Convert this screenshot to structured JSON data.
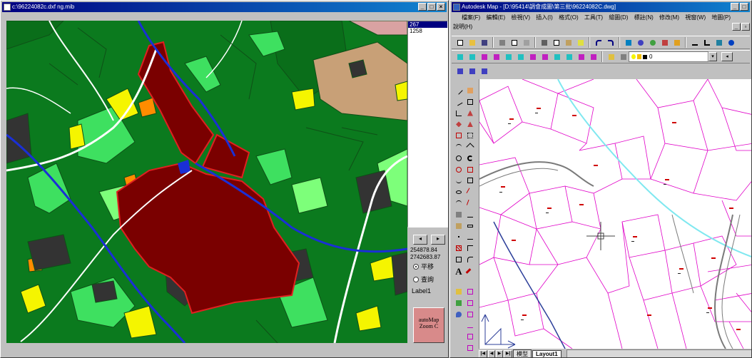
{
  "left_window": {
    "title": "c:\\96224082c.dxf ng.mib",
    "buttons": [
      "_",
      "□",
      "×"
    ],
    "sidebar_list": [
      "267",
      "1258"
    ],
    "coord_x": "254878.84",
    "coord_y": "2742683.87",
    "radio_pan": "平移",
    "radio_query": "查詢",
    "label": "Label1",
    "zoom_button": "autoMap Zoom C",
    "colors": {
      "dark_green": "#0b7a1e",
      "maroon": "#7a0000",
      "light_green": "#3ee060",
      "lime": "#7dff7a",
      "yellow": "#f5f500",
      "orange": "#ff8c00",
      "dark_gray": "#333333",
      "blue_road": "#1a2fd6",
      "tan": "#c8a077"
    }
  },
  "right_window": {
    "title": "Autodesk Map - [D:\\95414\\調會成圖\\第三批\\96224082C.dwg]",
    "buttons": [
      "_",
      "□",
      "×"
    ],
    "menu": [
      "檔案(F)",
      "編輯(E)",
      "檢視(V)",
      "插入(I)",
      "格式(O)",
      "工具(T)",
      "繪圖(D)",
      "標註(N)",
      "修改(M)",
      "視窗(W)",
      "地圖(P)"
    ],
    "menu2": [
      "說明(H)"
    ],
    "layer_value": "0",
    "tabs": [
      "模型",
      "Layout1"
    ],
    "nav_buttons": [
      "|◀",
      "◀",
      "▶",
      "▶|"
    ],
    "colors": {
      "magenta": "#e000c8",
      "cyan": "#80e8f0",
      "gray_road": "#7a7a7a",
      "navy_road": "#2d3f9a"
    }
  }
}
